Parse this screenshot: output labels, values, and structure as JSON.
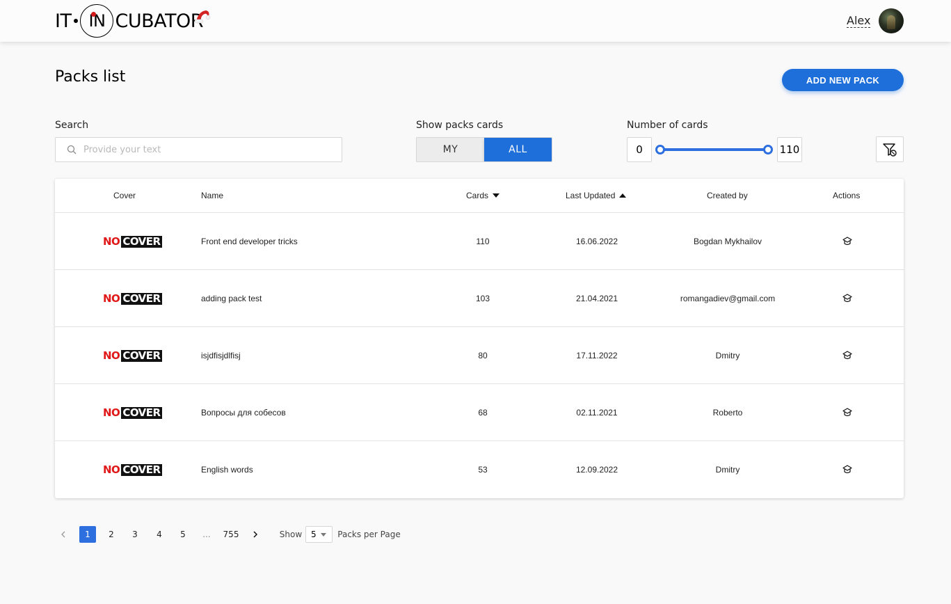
{
  "header": {
    "logo_it": "IT",
    "logo_in": "IN",
    "logo_cubator": "CUBATOR",
    "user_name": "Alex"
  },
  "page": {
    "title": "Packs list",
    "add_button": "ADD NEW PACK"
  },
  "filters": {
    "search_label": "Search",
    "search_placeholder": "Provide your text",
    "search_value": "",
    "show_label": "Show packs cards",
    "toggle_my": "MY",
    "toggle_all": "ALL",
    "toggle_selected": "ALL",
    "cards_label": "Number of cards",
    "min_value": "0",
    "max_value": "110"
  },
  "table": {
    "headers": {
      "cover": "Cover",
      "name": "Name",
      "cards": "Cards",
      "last_updated": "Last Updated",
      "created_by": "Created by",
      "actions": "Actions"
    },
    "cover_no": "NO",
    "cover_cover": "COVER",
    "rows": [
      {
        "name": "Front end developer tricks",
        "cards": "110",
        "updated": "16.06.2022",
        "created_by": "Bogdan Mykhailov"
      },
      {
        "name": "adding pack test",
        "cards": "103",
        "updated": "21.04.2021",
        "created_by": "romangadiev@gmail.com"
      },
      {
        "name": "isjdfisjdlfisj",
        "cards": "80",
        "updated": "17.11.2022",
        "created_by": "Dmitry"
      },
      {
        "name": "Вопросы для собесов",
        "cards": "68",
        "updated": "02.11.2021",
        "created_by": "Roberto"
      },
      {
        "name": "English words",
        "cards": "53",
        "updated": "12.09.2022",
        "created_by": "Dmitry"
      }
    ]
  },
  "pagination": {
    "pages": [
      "1",
      "2",
      "3",
      "4",
      "5",
      "...",
      "755"
    ],
    "current": "1",
    "show_label": "Show",
    "per_page": "5",
    "per_page_suffix": "Packs per Page"
  },
  "colors": {
    "accent": "#1e6fd9",
    "slider": "#2e6fe0",
    "nocover_red": "#e01818"
  }
}
